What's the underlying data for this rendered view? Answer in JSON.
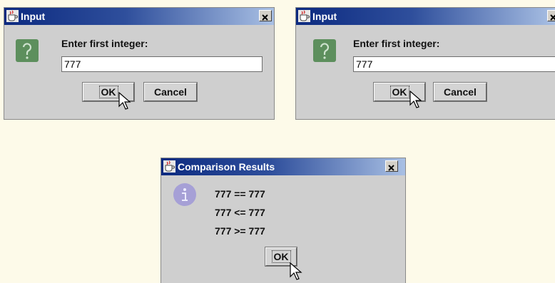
{
  "dialogs": {
    "input1": {
      "title": "Input",
      "prompt": "Enter first integer:",
      "value": "777",
      "ok_label": "OK",
      "cancel_label": "Cancel",
      "icon": "question-icon"
    },
    "input2": {
      "title": "Input",
      "prompt": "Enter first integer:",
      "value": "777",
      "ok_label": "OK",
      "cancel_label": "Cancel",
      "icon": "question-icon"
    },
    "results": {
      "title": "Comparison Results",
      "lines": [
        "777 == 777",
        "777 <= 777",
        "777 >= 777"
      ],
      "ok_label": "OK",
      "icon": "information-icon"
    }
  },
  "colors": {
    "background": "#fdfae9",
    "titlebar_start": "#0c2a80",
    "titlebar_end": "#a9c0e4",
    "dialog_body": "#cfcfcf",
    "question_icon": "#5d8f5d",
    "info_icon": "#a6a0d6"
  }
}
